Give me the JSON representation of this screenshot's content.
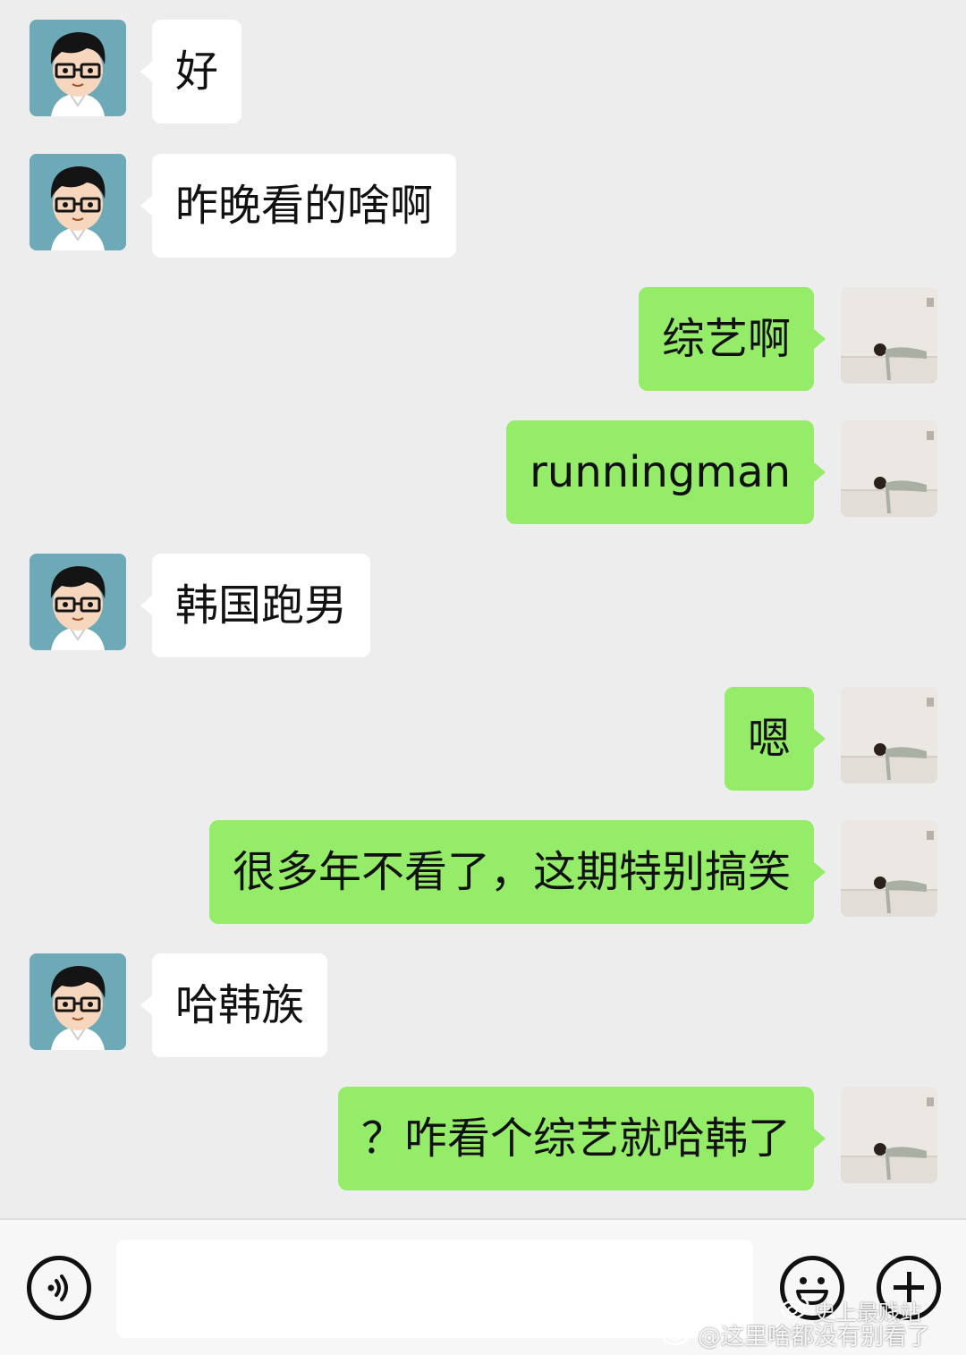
{
  "colors": {
    "background": "#ededed",
    "incoming_bubble": "#ffffff",
    "outgoing_bubble": "#95ec69",
    "input_bar": "#f7f7f7"
  },
  "messages": [
    {
      "side": "incoming",
      "text": "好"
    },
    {
      "side": "incoming",
      "text": "昨晚看的啥啊"
    },
    {
      "side": "outgoing",
      "text": "综艺啊"
    },
    {
      "side": "outgoing",
      "text": "runningman"
    },
    {
      "side": "incoming",
      "text": "韩国跑男"
    },
    {
      "side": "outgoing",
      "text": "嗯"
    },
    {
      "side": "outgoing",
      "text": "很多年不看了，这期特别搞笑"
    },
    {
      "side": "incoming",
      "text": "哈韩族"
    },
    {
      "side": "outgoing",
      "text": "？咋看个综艺就哈韩了"
    }
  ],
  "input_bar": {
    "voice_icon": "voice-icon",
    "emoji_icon": "emoji-icon",
    "plus_icon": "plus-icon",
    "text_value": ""
  },
  "watermark": {
    "account": "史上最贱站",
    "handle": "@这里啥都没有别看了"
  }
}
